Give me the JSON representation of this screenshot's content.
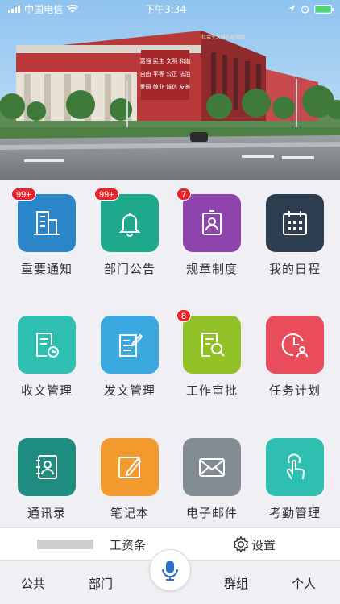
{
  "status": {
    "carrier": "中国电信",
    "time": "下午3:34"
  },
  "banner": {
    "sign_lines": [
      "富强 民主 文明 和谐",
      "自由 平等 公正 法治",
      "爱国 敬业 诚信 友善"
    ],
    "roof_text": "社会主义核心价值观"
  },
  "tiles": [
    {
      "label": "重要通知",
      "icon": "building-icon",
      "color": "#2a86c8",
      "badge": "99+"
    },
    {
      "label": "部门公告",
      "icon": "bell-icon",
      "color": "#1ea98d",
      "badge": "99+"
    },
    {
      "label": "规章制度",
      "icon": "badge-id-icon",
      "color": "#8e44ad",
      "badge": "7"
    },
    {
      "label": "我的日程",
      "icon": "calendar-icon",
      "color": "#2d3e50",
      "badge": ""
    },
    {
      "label": "收文管理",
      "icon": "doc-clock-icon",
      "color": "#2fbfb1",
      "badge": ""
    },
    {
      "label": "发文管理",
      "icon": "doc-edit-icon",
      "color": "#3ba8e0",
      "badge": ""
    },
    {
      "label": "工作审批",
      "icon": "doc-search-icon",
      "color": "#92c027",
      "badge": "8"
    },
    {
      "label": "任务计划",
      "icon": "clock-person-icon",
      "color": "#e94c5b",
      "badge": ""
    },
    {
      "label": "通讯录",
      "icon": "contacts-icon",
      "color": "#1f8c80",
      "badge": ""
    },
    {
      "label": "笔记本",
      "icon": "note-edit-icon",
      "color": "#f39a2e",
      "badge": ""
    },
    {
      "label": "电子邮件",
      "icon": "mail-icon",
      "color": "#838c93",
      "badge": ""
    },
    {
      "label": "考勤管理",
      "icon": "touch-icon",
      "color": "#2fbfb1",
      "badge": ""
    }
  ],
  "widgets": {
    "salary_label": "工资条",
    "settings_label": "设置"
  },
  "tabbar": {
    "tab1": "公共",
    "tab2": "部门",
    "tab3": "群组",
    "tab4": "个人"
  }
}
